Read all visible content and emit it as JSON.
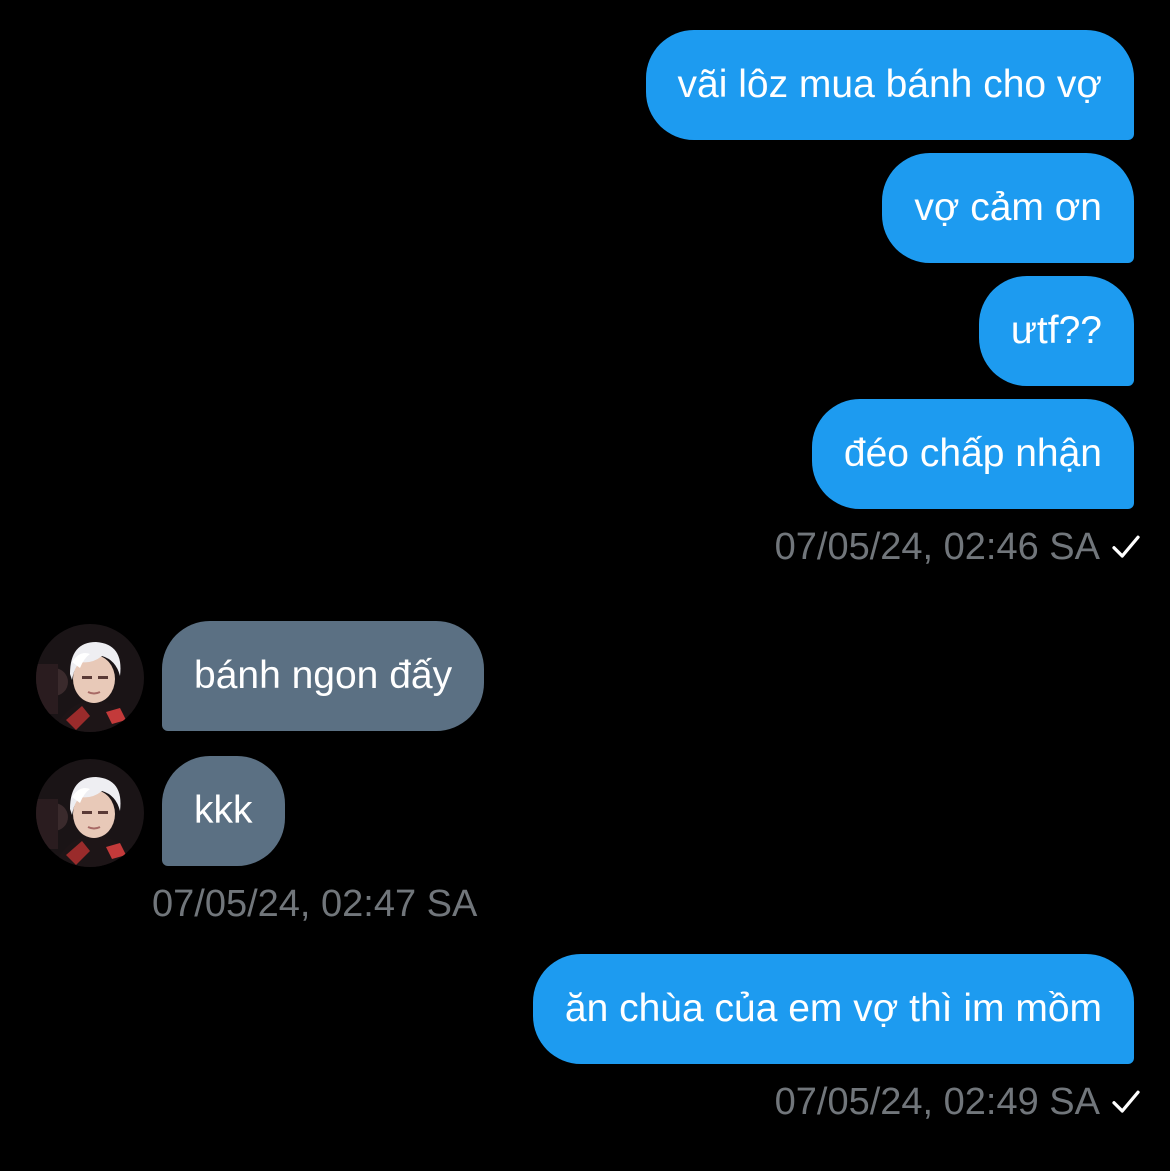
{
  "messages": [
    {
      "text": "vãi lôz mua bánh cho vợ"
    },
    {
      "text": "vợ cảm ơn"
    },
    {
      "text": "ưtf??"
    },
    {
      "text": "đéo chấp nhận"
    },
    {
      "text": "bánh ngon đấy"
    },
    {
      "text": "kkk"
    },
    {
      "text": "ăn chùa của em vợ thì im mồm"
    }
  ],
  "timestamps": [
    "07/05/24, 02:46 SA",
    "07/05/24, 02:47 SA",
    "07/05/24, 02:49 SA"
  ],
  "colors": {
    "background": "#000000",
    "sent_bubble": "#1d9bf0",
    "received_bubble": "#5b7083",
    "timestamp": "#71767b"
  },
  "icons": {
    "read_receipt": "checkmark-icon"
  }
}
